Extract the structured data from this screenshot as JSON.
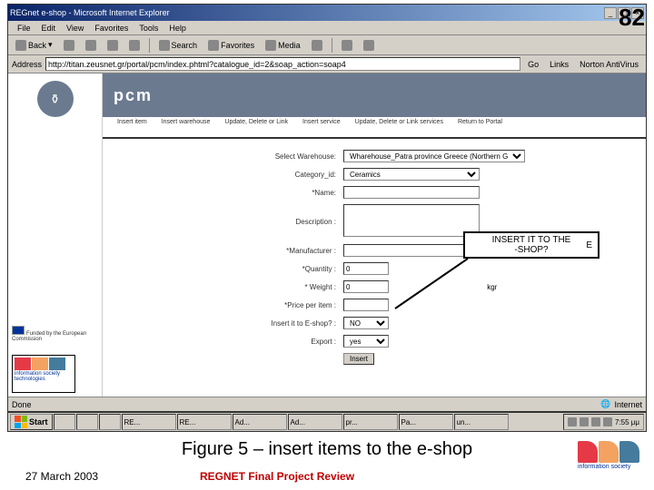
{
  "page_number": "82",
  "browser": {
    "title": "REGnet e-shop - Microsoft Internet Explorer",
    "menu": [
      "File",
      "Edit",
      "View",
      "Favorites",
      "Tools",
      "Help"
    ],
    "toolbar": {
      "back": "Back",
      "search": "Search",
      "favorites": "Favorites",
      "media": "Media"
    },
    "address_label": "Address",
    "url": "http://titan.zeusnet.gr/portal/pcm/index.phtml?catalogue_id=2&soap_action=soap4",
    "go": "Go",
    "links": "Links",
    "norton": "Norton AntiVirus"
  },
  "pcm": {
    "brand": "pcm",
    "nav": [
      "Insert\nitem",
      "Insert\nwarehouse",
      "Update, Delete\nor Link",
      "Insert\nservice",
      "Update, Delete or\nLink services",
      "Return to\nPortal"
    ]
  },
  "form": {
    "labels": {
      "warehouse": "Select Warehouse:",
      "category": "Category_id:",
      "name": "*Name:",
      "description": "Description :",
      "manufacturer": "*Manufacturer :",
      "quantity": "*Quantity :",
      "weight": "* Weight :",
      "price": "*Price per item :",
      "insert_eshop": "Insert it to E-shop? :",
      "export": "Export :"
    },
    "values": {
      "warehouse": "Wharehouse_Patra province Greece (Northern Greece)",
      "category": "Ceramics",
      "quantity": "0",
      "weight": "0",
      "weight_unit": "kgr",
      "insert_eshop": "NO",
      "export": "yes"
    },
    "submit": "Insert"
  },
  "left": {
    "funded": "Funded by the European Commission",
    "ist": "information society technologies"
  },
  "statusbar": {
    "done": "Done",
    "zone": "Internet"
  },
  "callout": {
    "text": "INSERT IT TO THE\n-SHOP?",
    "e": "E"
  },
  "taskbar": {
    "start": "Start",
    "items": [
      "",
      "",
      "",
      "RE...",
      "RE...",
      "Ad...",
      "Ad...",
      "pr...",
      "Pa...",
      "un..."
    ],
    "time": "7:55 μμ"
  },
  "caption": "Figure 5 – insert items to the e-shop",
  "footer": {
    "date": "27 March 2003",
    "title": "REGNET Final Project Review",
    "ist": "information society"
  }
}
